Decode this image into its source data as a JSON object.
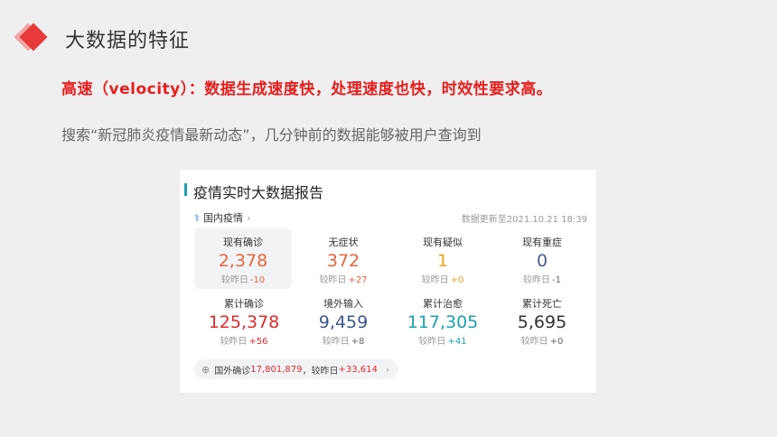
{
  "slide": {
    "title": "大数据的特征",
    "headline": "高速（velocity）：数据生成速度快，处理速度也快，时效性要求高。",
    "description": "搜索“新冠肺炎疫情最新动态”，几分钟前的数据能够被用户查询到"
  },
  "card": {
    "title": "疫情实时大数据报告",
    "domestic_label": "国内疫情",
    "updated": "数据更新至2021.10.21 18:39",
    "delta_prefix": "较昨日",
    "stats": [
      {
        "label": "现有确诊",
        "value": "2,378",
        "delta": "-10",
        "value_color": "#e8643a",
        "delta_color": "#e8643a",
        "selected": true
      },
      {
        "label": "无症状",
        "value": "372",
        "delta": "+27",
        "value_color": "#e8643a",
        "delta_color": "#e8643a"
      },
      {
        "label": "现有疑似",
        "value": "1",
        "delta": "+0",
        "value_color": "#f0a020",
        "delta_color": "#f0a020"
      },
      {
        "label": "现有重症",
        "value": "0",
        "delta": "-1",
        "value_color": "#4a5f8c",
        "delta_color": "#666666"
      },
      {
        "label": "累计确诊",
        "value": "125,378",
        "delta": "+56",
        "value_color": "#e02a2a",
        "delta_color": "#e02a2a"
      },
      {
        "label": "境外输入",
        "value": "9,459",
        "delta": "+8",
        "value_color": "#3a5a8c",
        "delta_color": "#666666"
      },
      {
        "label": "累计治愈",
        "value": "117,305",
        "delta": "+41",
        "value_color": "#1aa1b2",
        "delta_color": "#1aa1b2"
      },
      {
        "label": "累计死亡",
        "value": "5,695",
        "delta": "+0",
        "value_color": "#333333",
        "delta_color": "#666666"
      }
    ],
    "foreign": {
      "label": "国外确诊",
      "value": "17,801,879",
      "sep": "，较昨日",
      "delta": "+33,614"
    }
  },
  "colors": {
    "accent_red": "#e61e1e",
    "teal": "#1aa1b2"
  },
  "icons": {
    "title_marker": "diamond-icon",
    "domestic": "lungs-icon",
    "foreign": "globe-icon"
  }
}
